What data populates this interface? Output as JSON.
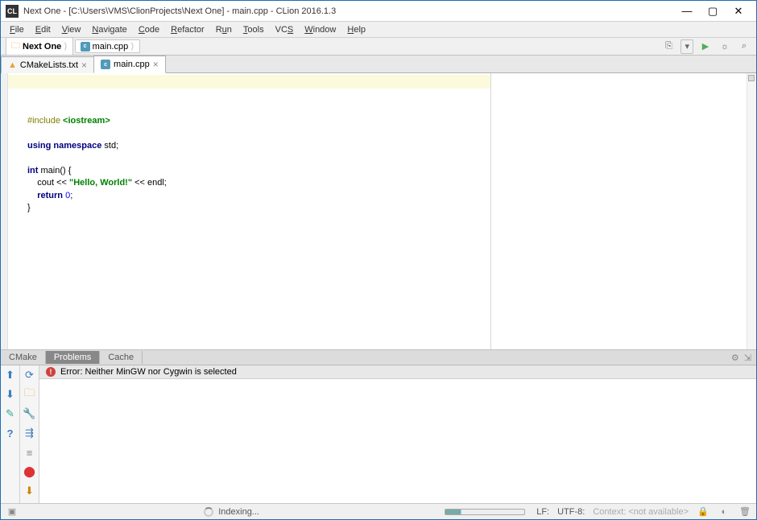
{
  "title": "Next One - [C:\\Users\\VMS\\ClionProjects\\Next One] - main.cpp - CLion 2016.1.3",
  "menu": [
    "File",
    "Edit",
    "View",
    "Navigate",
    "Code",
    "Refactor",
    "Run",
    "Tools",
    "VCS",
    "Window",
    "Help"
  ],
  "breadcrumbs": [
    {
      "label": "Next One",
      "icon": "folder"
    },
    {
      "label": "main.cpp",
      "icon": "cpp"
    }
  ],
  "tabs": [
    {
      "label": "CMakeLists.txt",
      "icon": "warn",
      "active": false
    },
    {
      "label": "main.cpp",
      "icon": "cpp",
      "active": true
    }
  ],
  "code": {
    "l1_inc": "#include",
    "l1_val": "<iostream>",
    "l3_using": "using",
    "l3_ns": "namespace",
    "l3_std": "std;",
    "l5_int": "int",
    "l5_main": "main() {",
    "l6": "    cout << ",
    "l6_str": "\"Hello, World!\"",
    "l6_end": " << endl;",
    "l7_ret": "    return ",
    "l7_val": "0",
    "l7_sc": ";",
    "l8": "}"
  },
  "panel": {
    "tabs": [
      "CMake",
      "Problems",
      "Cache"
    ],
    "active": "Problems",
    "error": "Error: Neither MinGW nor Cygwin is selected"
  },
  "status": {
    "indexing": "Indexing...",
    "lf": "LF:",
    "encoding": "UTF-8:",
    "context_label": "Context:",
    "context_value": "<not available>"
  }
}
